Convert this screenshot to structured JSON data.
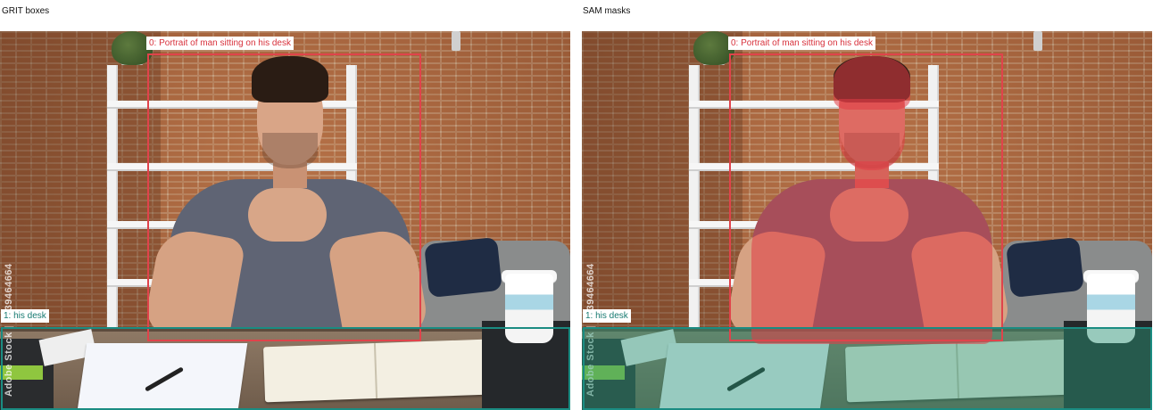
{
  "panels": {
    "left_title": "GRIT boxes",
    "right_title": "SAM masks"
  },
  "annotations": [
    {
      "index": 0,
      "label": "0: Portrait of man sitting on his desk",
      "color": "#e0434b"
    },
    {
      "index": 1,
      "label": "1: his desk",
      "color": "#1a8c82"
    }
  ],
  "watermark": "Adobe Stock | #439464664"
}
